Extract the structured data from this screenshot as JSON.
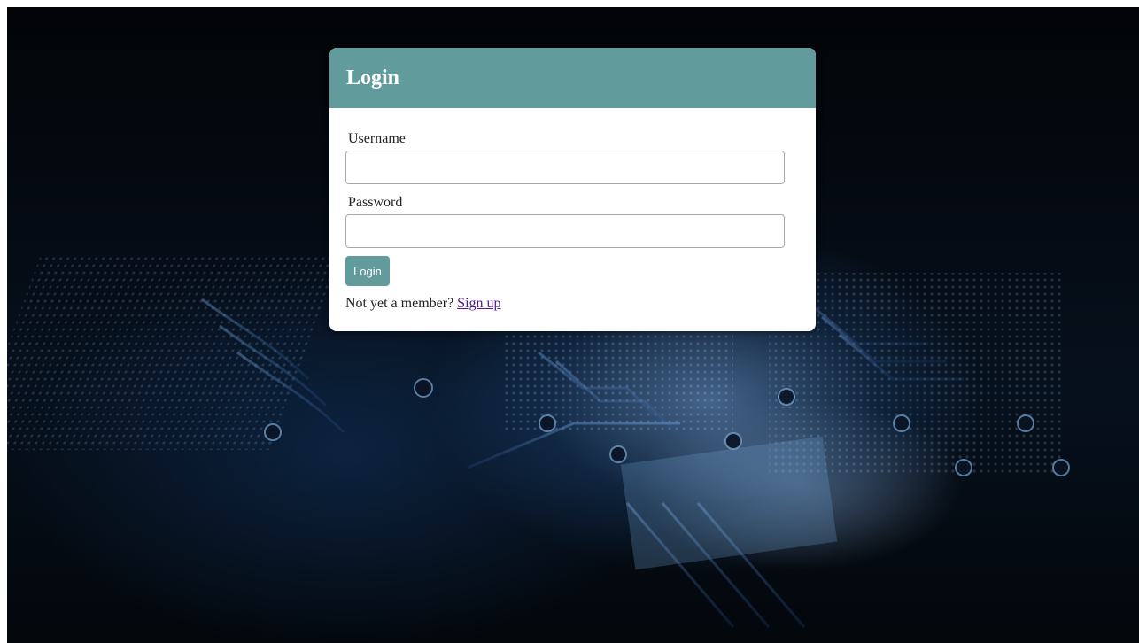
{
  "login_card": {
    "title": "Login",
    "username_label": "Username",
    "username_value": "",
    "password_label": "Password",
    "password_value": "",
    "submit_label": "Login",
    "signup_prompt": "Not yet a member?",
    "signup_link": "Sign up"
  },
  "colors": {
    "header_background": "#629b9b",
    "button_background": "#629b9b",
    "link_visited": "#551a8b",
    "page_background_accent": "#1e5aa0"
  },
  "background": {
    "image_description_icon": "circuit-board-background"
  }
}
